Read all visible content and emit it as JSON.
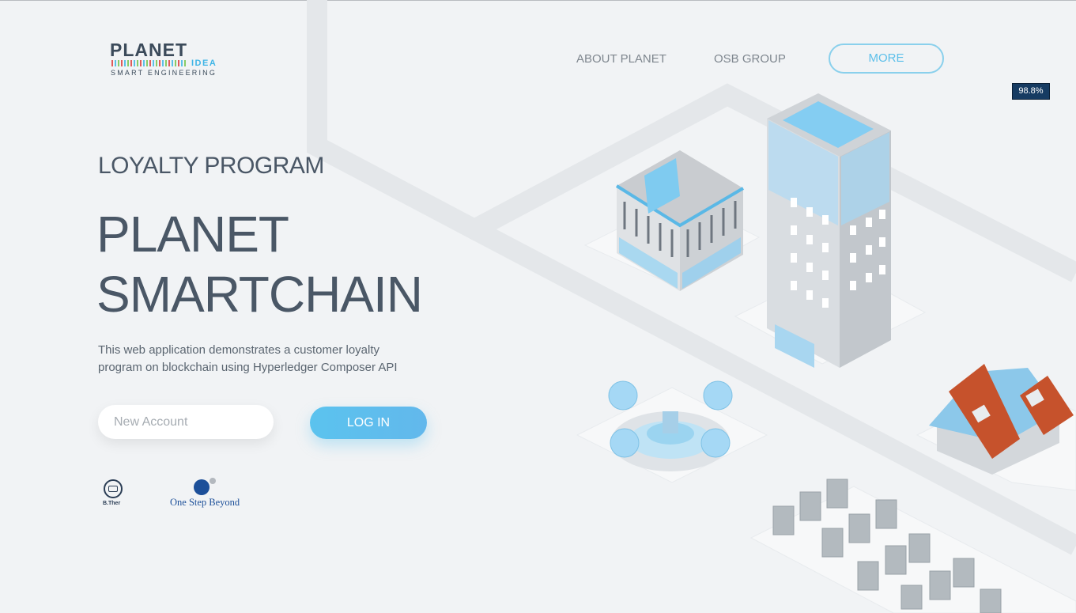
{
  "brand": {
    "logo_word": "PLANET",
    "logo_idea": "IDEA",
    "logo_sub": "SMART ENGINEERING"
  },
  "nav": {
    "about": "ABOUT PLANET",
    "osb": "OSB GROUP",
    "more": "MORE"
  },
  "zoom_badge": "98.8%",
  "hero": {
    "eyebrow": "LOYALTY PROGRAM",
    "title_line1": "PLANET",
    "title_line2": "SMARTCHAIN",
    "desc_line1": "This web application demonstrates a customer loyalty",
    "desc_line2": "program on blockchain using Hyperledger Composer API"
  },
  "form": {
    "account_placeholder": "New Account",
    "account_value": "",
    "login_label": "LOG IN"
  },
  "partners": {
    "bther": "B.Ther",
    "osb": "One Step Beyond"
  },
  "colors": {
    "accent": "#5bc3ee",
    "text_dark": "#4a5766",
    "background": "#f1f3f5"
  }
}
